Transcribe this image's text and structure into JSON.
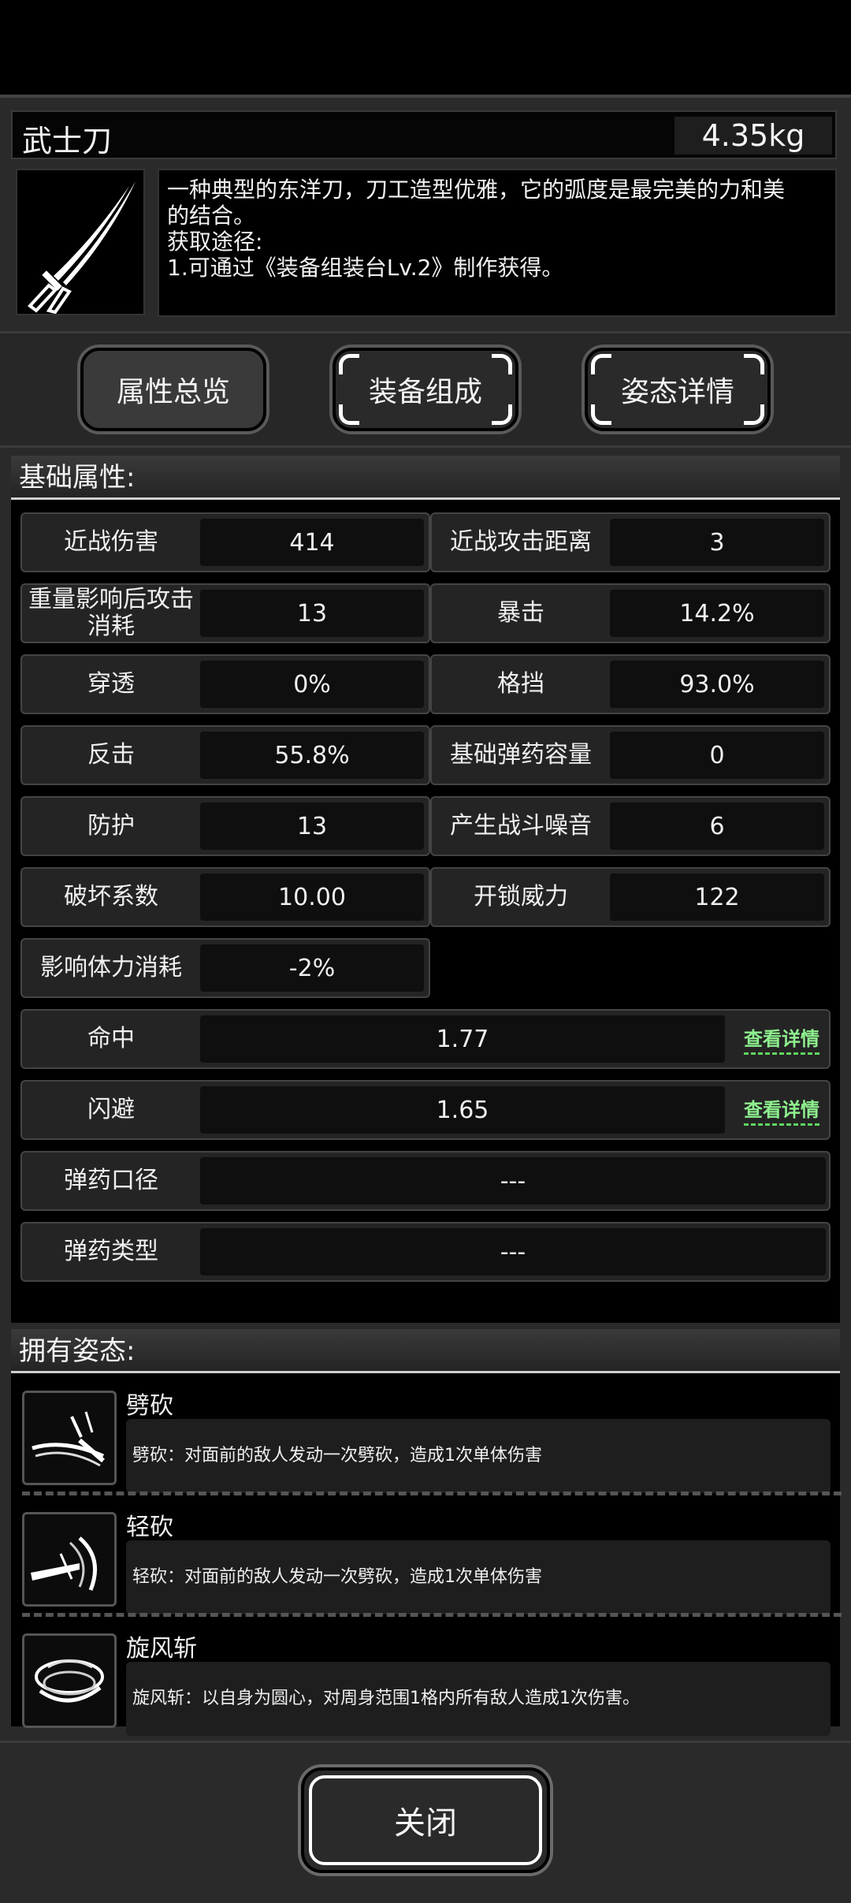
{
  "item": {
    "name": "武士刀",
    "weight": "4.35kg",
    "description_lines": [
      "一种典型的东洋刀，刀工造型优雅，它的弧度是最完美的力和美",
      "的结合。",
      "获取途径:",
      "1.可通过《装备组装台Lv.2》制作获得。"
    ],
    "icon": "katana-icon"
  },
  "tabs": [
    {
      "label": "属性总览",
      "active": true
    },
    {
      "label": "装备组成",
      "active": false
    },
    {
      "label": "姿态详情",
      "active": false
    }
  ],
  "basic": {
    "title": "基础属性:",
    "left": [
      {
        "label": "近战伤害",
        "value": "414"
      },
      {
        "label": "重量影响后攻击消耗",
        "value": "13"
      },
      {
        "label": "穿透",
        "value": "0%"
      },
      {
        "label": "反击",
        "value": "55.8%"
      },
      {
        "label": "防护",
        "value": "13"
      },
      {
        "label": "破坏系数",
        "value": "10.00"
      },
      {
        "label": "影响体力消耗",
        "value": "-2%"
      }
    ],
    "right": [
      {
        "label": "近战攻击距离",
        "value": "3"
      },
      {
        "label": "暴击",
        "value": "14.2%"
      },
      {
        "label": "格挡",
        "value": "93.0%"
      },
      {
        "label": "基础弹药容量",
        "value": "0"
      },
      {
        "label": "产生战斗噪音",
        "value": "6"
      },
      {
        "label": "开锁威力",
        "value": "122"
      }
    ],
    "wide": [
      {
        "label": "命中",
        "value": "1.77",
        "link": "查看详情"
      },
      {
        "label": "闪避",
        "value": "1.65",
        "link": "查看详情"
      },
      {
        "label": "弹药口径",
        "value": "---"
      },
      {
        "label": "弹药类型",
        "value": "---"
      }
    ]
  },
  "stances": {
    "title": "拥有姿态:",
    "items": [
      {
        "name": "劈砍",
        "desc": "劈砍：对面前的敌人发动一次劈砍，造成1次单体伤害",
        "icon": "slash-icon"
      },
      {
        "name": "轻砍",
        "desc": "轻砍：对面前的敌人发动一次劈砍，造成1次单体伤害",
        "icon": "light-cut-icon"
      },
      {
        "name": "旋风斩",
        "desc": "旋风斩：以自身为圆心，对周身范围1格内所有敌人造成1次伤害。",
        "icon": "whirlwind-icon"
      }
    ]
  },
  "close_label": "关闭"
}
